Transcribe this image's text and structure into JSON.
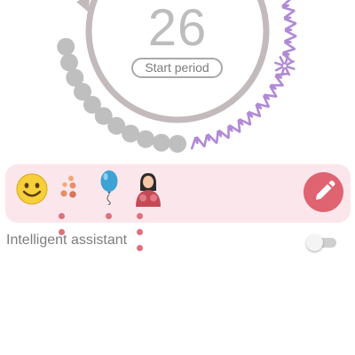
{
  "cycle": {
    "day": "26",
    "start_label": "Start period",
    "colors": {
      "track": "#c3bbbb",
      "past_dots": "#bfbfbf",
      "fertile": "#b08ad6"
    }
  },
  "log_panel": {
    "icons": [
      {
        "name": "mood-smiley-icon",
        "dots": 0
      },
      {
        "name": "symptoms-icon",
        "dots": 2
      },
      {
        "name": "sex-balloon-icon",
        "dots": 1
      },
      {
        "name": "body-woman-icon",
        "dots": 3
      }
    ],
    "edit_icon": "pencil-icon"
  },
  "assistant": {
    "label": "Intelligent assistant",
    "enabled": false
  }
}
